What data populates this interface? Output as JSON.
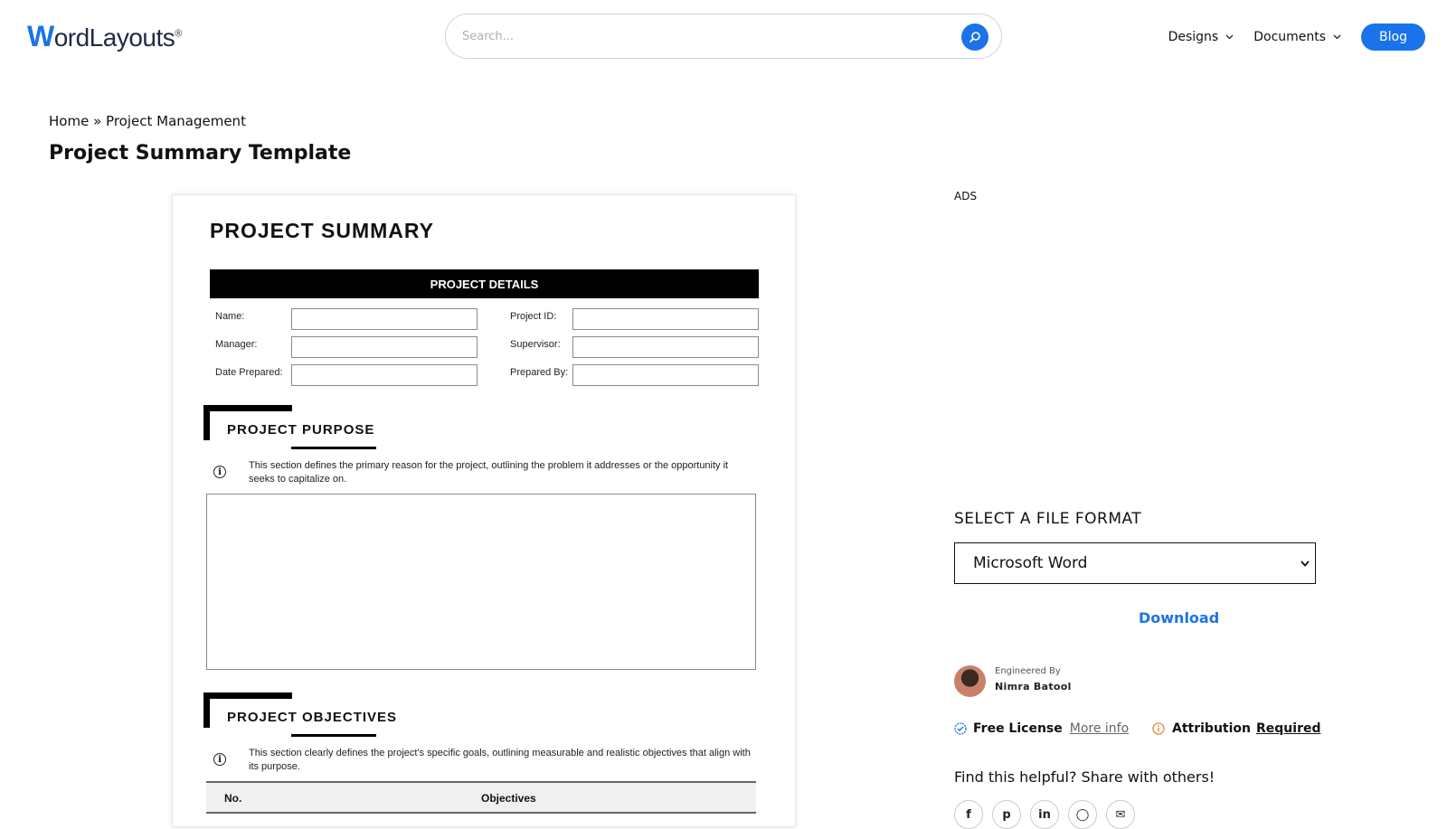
{
  "header": {
    "logo": {
      "first": "W",
      "rest": "ordLayouts",
      "mark": "®"
    },
    "search": {
      "placeholder": "Search..."
    },
    "nav": {
      "designs": "Designs",
      "documents": "Documents",
      "blog": "Blog"
    }
  },
  "breadcrumb": {
    "home": "Home",
    "separator": "»",
    "category": "Project Management"
  },
  "page_title": "Project Summary Template",
  "document": {
    "title": "PROJECT SUMMARY",
    "details_header": "PROJECT DETAILS",
    "fields": {
      "name": "Name:",
      "project_id": "Project ID:",
      "manager": "Manager:",
      "supervisor": "Supervisor:",
      "date_prepared": "Date Prepared:",
      "prepared_by": "Prepared By:"
    },
    "purpose": {
      "title": "PROJECT PURPOSE",
      "info": "This section defines the primary reason for the project, outlining the problem it addresses or the opportunity it seeks to capitalize on."
    },
    "objectives": {
      "title": "PROJECT OBJECTIVES",
      "info": "This section clearly defines the project's specific goals, outlining measurable and realistic objectives that align with its purpose.",
      "columns": [
        "No.",
        "Objectives"
      ]
    },
    "info_glyph": "i"
  },
  "sidebar": {
    "ads": "ADS",
    "format_label": "SELECT A FILE FORMAT",
    "format_selected": "Microsoft Word",
    "download": "Download",
    "engineered_by": "Engineered By",
    "author": "Nimra Batool",
    "license": {
      "label": "Free License",
      "more": "More info"
    },
    "attribution": {
      "label": "Attribution",
      "value": "Required"
    },
    "share_label": "Find this helpful? Share with others!",
    "share_icons": [
      "facebook-icon",
      "pinterest-icon",
      "linkedin-icon",
      "whatsapp-icon",
      "email-icon"
    ]
  },
  "colors": {
    "accent": "#1a73e8",
    "text": "#111111",
    "doc_bar": "#000000"
  }
}
